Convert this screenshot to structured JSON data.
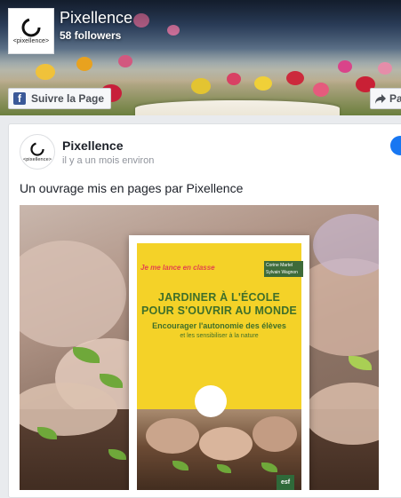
{
  "header": {
    "page_name": "Pixellence",
    "followers": "58 followers",
    "logo_text": "<pixellence>",
    "follow_button": "Suivre la Page",
    "share_button": "Pa"
  },
  "post": {
    "author": "Pixellence",
    "timestamp": "il y a un mois environ",
    "avatar_text": "<pixellence>",
    "text": "Un ouvrage mis en pages par Pixellence"
  },
  "book_cover": {
    "tagline": "Je me lance en classe",
    "authors": "Corine Martel\nSylvain Wagnon",
    "title_line1": "JARDINER À L'ÉCOLE",
    "title_line2": "POUR S'OUVRIR AU MONDE",
    "subtitle": "Encourager l'autonomie des élèves",
    "subtitle2": "et les sensibiliser à la nature",
    "publisher": "esf"
  },
  "colors": {
    "facebook_blue": "#3b5998",
    "book_yellow": "#f4d228",
    "book_green": "#3f6f2a"
  },
  "icons": {
    "follow": "facebook-icon",
    "share": "share-icon",
    "corner": "facebook-icon"
  }
}
